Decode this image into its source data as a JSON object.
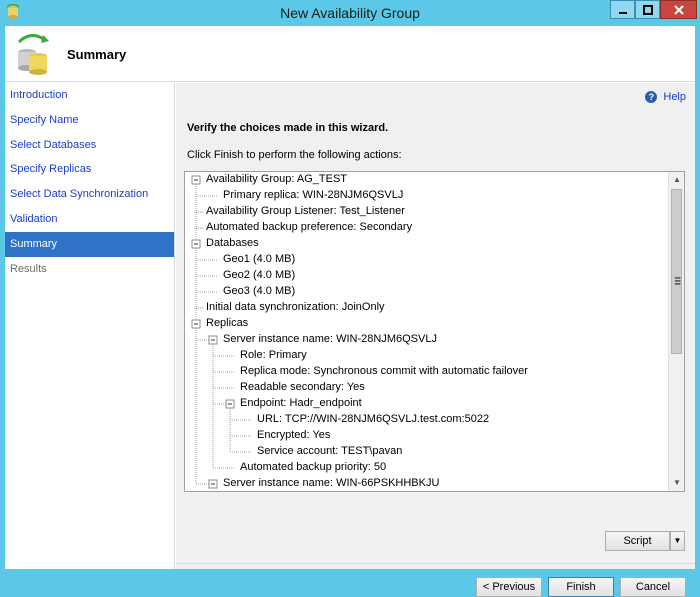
{
  "window": {
    "title": "New Availability Group"
  },
  "header": {
    "page_title": "Summary"
  },
  "sidebar": {
    "items": [
      {
        "label": "Introduction",
        "state": "link"
      },
      {
        "label": "Specify Name",
        "state": "link"
      },
      {
        "label": "Select Databases",
        "state": "link"
      },
      {
        "label": "Specify Replicas",
        "state": "link"
      },
      {
        "label": "Select Data Synchronization",
        "state": "link"
      },
      {
        "label": "Validation",
        "state": "link"
      },
      {
        "label": "Summary",
        "state": "active"
      },
      {
        "label": "Results",
        "state": "disabled"
      }
    ]
  },
  "main": {
    "help_label": "Help",
    "verify_text": "Verify the choices made in this wizard.",
    "instruction_text": "Click Finish to perform the following actions:",
    "tree": [
      {
        "text": "Availability Group: AG_TEST",
        "level": 0,
        "expander": true
      },
      {
        "text": "Primary replica: WIN-28NJM6QSVLJ",
        "level": 1
      },
      {
        "text": "Availability Group Listener: Test_Listener",
        "level": 0
      },
      {
        "text": "Automated backup preference: Secondary",
        "level": 0
      },
      {
        "text": "Databases",
        "level": 0,
        "expander": true
      },
      {
        "text": "Geo1 (4.0 MB)",
        "level": 1
      },
      {
        "text": "Geo2 (4.0 MB)",
        "level": 1
      },
      {
        "text": "Geo3 (4.0 MB)",
        "level": 1
      },
      {
        "text": "Initial data synchronization: JoinOnly",
        "level": 0
      },
      {
        "text": "Replicas",
        "level": 0,
        "expander": true
      },
      {
        "text": "Server instance name: WIN-28NJM6QSVLJ",
        "level": 1,
        "expander": true
      },
      {
        "text": "Role: Primary",
        "level": 2
      },
      {
        "text": "Replica mode: Synchronous commit with automatic failover",
        "level": 2
      },
      {
        "text": "Readable secondary: Yes",
        "level": 2
      },
      {
        "text": "Endpoint: Hadr_endpoint",
        "level": 2,
        "expander": true
      },
      {
        "text": "URL: TCP://WIN-28NJM6QSVLJ.test.com:5022",
        "level": 3
      },
      {
        "text": "Encrypted: Yes",
        "level": 3
      },
      {
        "text": "Service account: TEST\\pavan",
        "level": 3
      },
      {
        "text": "Automated backup priority: 50",
        "level": 2
      },
      {
        "text": "Server instance name: WIN-66PSKHHBKJU",
        "level": 1,
        "expander": true
      }
    ]
  },
  "footer": {
    "script_label": "Script",
    "previous_label": "< Previous",
    "finish_label": "Finish",
    "cancel_label": "Cancel"
  },
  "colors": {
    "title_bar": "#5bc8e8",
    "active_nav": "#3072c5",
    "link": "#1a3cc8",
    "close_button": "#c7463f"
  },
  "icons": {
    "app": "database-sync-icon",
    "header": "availability-group-icon",
    "help": "help-icon"
  }
}
